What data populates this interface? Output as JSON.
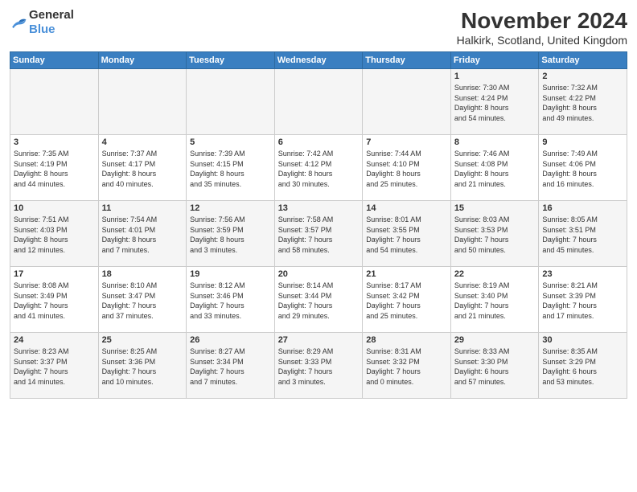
{
  "logo": {
    "general": "General",
    "blue": "Blue"
  },
  "header": {
    "month": "November 2024",
    "location": "Halkirk, Scotland, United Kingdom"
  },
  "weekdays": [
    "Sunday",
    "Monday",
    "Tuesday",
    "Wednesday",
    "Thursday",
    "Friday",
    "Saturday"
  ],
  "weeks": [
    [
      {
        "day": "",
        "info": ""
      },
      {
        "day": "",
        "info": ""
      },
      {
        "day": "",
        "info": ""
      },
      {
        "day": "",
        "info": ""
      },
      {
        "day": "",
        "info": ""
      },
      {
        "day": "1",
        "info": "Sunrise: 7:30 AM\nSunset: 4:24 PM\nDaylight: 8 hours\nand 54 minutes."
      },
      {
        "day": "2",
        "info": "Sunrise: 7:32 AM\nSunset: 4:22 PM\nDaylight: 8 hours\nand 49 minutes."
      }
    ],
    [
      {
        "day": "3",
        "info": "Sunrise: 7:35 AM\nSunset: 4:19 PM\nDaylight: 8 hours\nand 44 minutes."
      },
      {
        "day": "4",
        "info": "Sunrise: 7:37 AM\nSunset: 4:17 PM\nDaylight: 8 hours\nand 40 minutes."
      },
      {
        "day": "5",
        "info": "Sunrise: 7:39 AM\nSunset: 4:15 PM\nDaylight: 8 hours\nand 35 minutes."
      },
      {
        "day": "6",
        "info": "Sunrise: 7:42 AM\nSunset: 4:12 PM\nDaylight: 8 hours\nand 30 minutes."
      },
      {
        "day": "7",
        "info": "Sunrise: 7:44 AM\nSunset: 4:10 PM\nDaylight: 8 hours\nand 25 minutes."
      },
      {
        "day": "8",
        "info": "Sunrise: 7:46 AM\nSunset: 4:08 PM\nDaylight: 8 hours\nand 21 minutes."
      },
      {
        "day": "9",
        "info": "Sunrise: 7:49 AM\nSunset: 4:06 PM\nDaylight: 8 hours\nand 16 minutes."
      }
    ],
    [
      {
        "day": "10",
        "info": "Sunrise: 7:51 AM\nSunset: 4:03 PM\nDaylight: 8 hours\nand 12 minutes."
      },
      {
        "day": "11",
        "info": "Sunrise: 7:54 AM\nSunset: 4:01 PM\nDaylight: 8 hours\nand 7 minutes."
      },
      {
        "day": "12",
        "info": "Sunrise: 7:56 AM\nSunset: 3:59 PM\nDaylight: 8 hours\nand 3 minutes."
      },
      {
        "day": "13",
        "info": "Sunrise: 7:58 AM\nSunset: 3:57 PM\nDaylight: 7 hours\nand 58 minutes."
      },
      {
        "day": "14",
        "info": "Sunrise: 8:01 AM\nSunset: 3:55 PM\nDaylight: 7 hours\nand 54 minutes."
      },
      {
        "day": "15",
        "info": "Sunrise: 8:03 AM\nSunset: 3:53 PM\nDaylight: 7 hours\nand 50 minutes."
      },
      {
        "day": "16",
        "info": "Sunrise: 8:05 AM\nSunset: 3:51 PM\nDaylight: 7 hours\nand 45 minutes."
      }
    ],
    [
      {
        "day": "17",
        "info": "Sunrise: 8:08 AM\nSunset: 3:49 PM\nDaylight: 7 hours\nand 41 minutes."
      },
      {
        "day": "18",
        "info": "Sunrise: 8:10 AM\nSunset: 3:47 PM\nDaylight: 7 hours\nand 37 minutes."
      },
      {
        "day": "19",
        "info": "Sunrise: 8:12 AM\nSunset: 3:46 PM\nDaylight: 7 hours\nand 33 minutes."
      },
      {
        "day": "20",
        "info": "Sunrise: 8:14 AM\nSunset: 3:44 PM\nDaylight: 7 hours\nand 29 minutes."
      },
      {
        "day": "21",
        "info": "Sunrise: 8:17 AM\nSunset: 3:42 PM\nDaylight: 7 hours\nand 25 minutes."
      },
      {
        "day": "22",
        "info": "Sunrise: 8:19 AM\nSunset: 3:40 PM\nDaylight: 7 hours\nand 21 minutes."
      },
      {
        "day": "23",
        "info": "Sunrise: 8:21 AM\nSunset: 3:39 PM\nDaylight: 7 hours\nand 17 minutes."
      }
    ],
    [
      {
        "day": "24",
        "info": "Sunrise: 8:23 AM\nSunset: 3:37 PM\nDaylight: 7 hours\nand 14 minutes."
      },
      {
        "day": "25",
        "info": "Sunrise: 8:25 AM\nSunset: 3:36 PM\nDaylight: 7 hours\nand 10 minutes."
      },
      {
        "day": "26",
        "info": "Sunrise: 8:27 AM\nSunset: 3:34 PM\nDaylight: 7 hours\nand 7 minutes."
      },
      {
        "day": "27",
        "info": "Sunrise: 8:29 AM\nSunset: 3:33 PM\nDaylight: 7 hours\nand 3 minutes."
      },
      {
        "day": "28",
        "info": "Sunrise: 8:31 AM\nSunset: 3:32 PM\nDaylight: 7 hours\nand 0 minutes."
      },
      {
        "day": "29",
        "info": "Sunrise: 8:33 AM\nSunset: 3:30 PM\nDaylight: 6 hours\nand 57 minutes."
      },
      {
        "day": "30",
        "info": "Sunrise: 8:35 AM\nSunset: 3:29 PM\nDaylight: 6 hours\nand 53 minutes."
      }
    ]
  ]
}
